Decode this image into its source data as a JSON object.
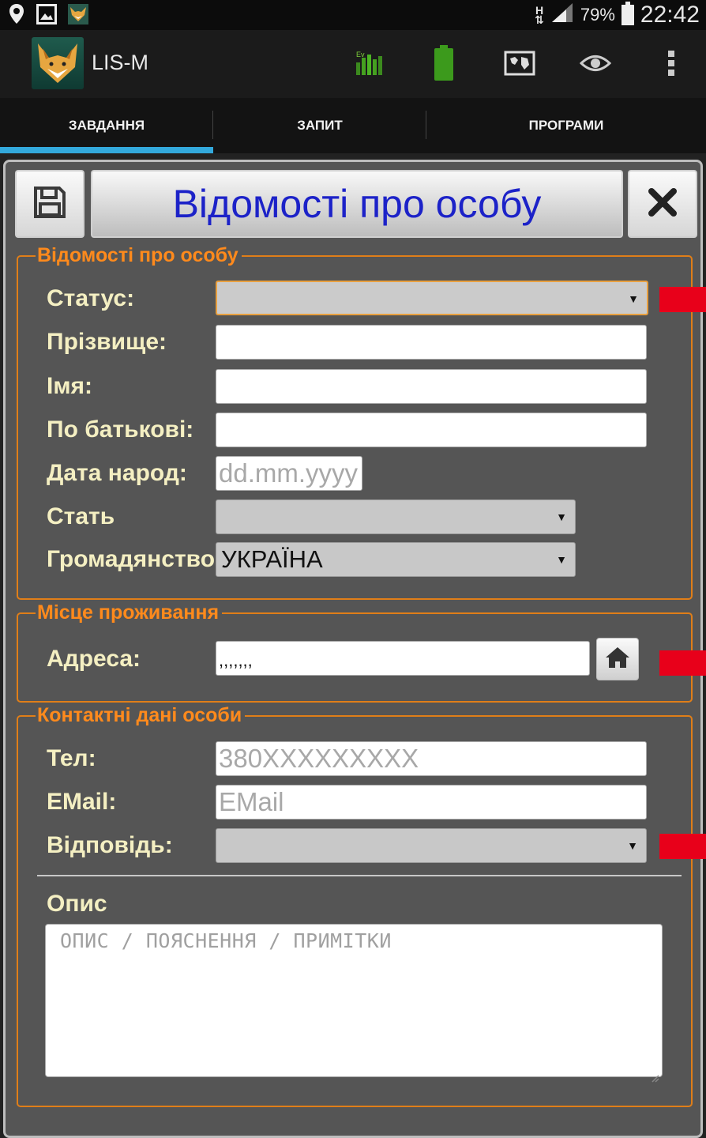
{
  "status_bar": {
    "network_type": "H",
    "battery_percent": "79%",
    "time": "22:42"
  },
  "app": {
    "title": "LIS-M"
  },
  "tabs": [
    {
      "label": "ЗАВДАННЯ",
      "active": true
    },
    {
      "label": "ЗАПИТ",
      "active": false
    },
    {
      "label": "ПРОГРАМИ",
      "active": false
    }
  ],
  "form": {
    "title": "Відомості про особу",
    "sections": {
      "person": {
        "legend": "Відомості про особу",
        "status_label": "Статус:",
        "status_value": "",
        "surname_label": "Прізвище:",
        "surname_value": "",
        "name_label": "Імя:",
        "name_value": "",
        "patronymic_label": "По батькові:",
        "patronymic_value": "",
        "birthdate_label": "Дата народ:",
        "birthdate_placeholder": "dd.mm.yyyy",
        "sex_label": "Стать",
        "sex_value": "",
        "citizenship_label": "Громадянство",
        "citizenship_value": "УКРАЇНА"
      },
      "residence": {
        "legend": "Місце проживання",
        "address_label": "Адреса:",
        "address_value": ",,,,,,,"
      },
      "contacts": {
        "legend": "Контактні дані особи",
        "phone_label": "Тел:",
        "phone_placeholder": "380XXXXXXXXX",
        "email_label": "EMail:",
        "email_placeholder": "EMail",
        "answer_label": "Відповідь:",
        "answer_value": "",
        "description_label": "Опис",
        "description_placeholder": "ОПИС / ПОЯСНЕННЯ / ПРИМІТКИ"
      }
    }
  },
  "colors": {
    "accent_tab": "#33a9dc",
    "legend_orange": "#ff8a1c",
    "label_cream": "#f4efc2",
    "title_blue": "#1c22c8",
    "marker_red": "#e8001a"
  },
  "icons": {
    "save": "floppy-disk-icon",
    "close": "close-icon",
    "home": "home-icon"
  }
}
